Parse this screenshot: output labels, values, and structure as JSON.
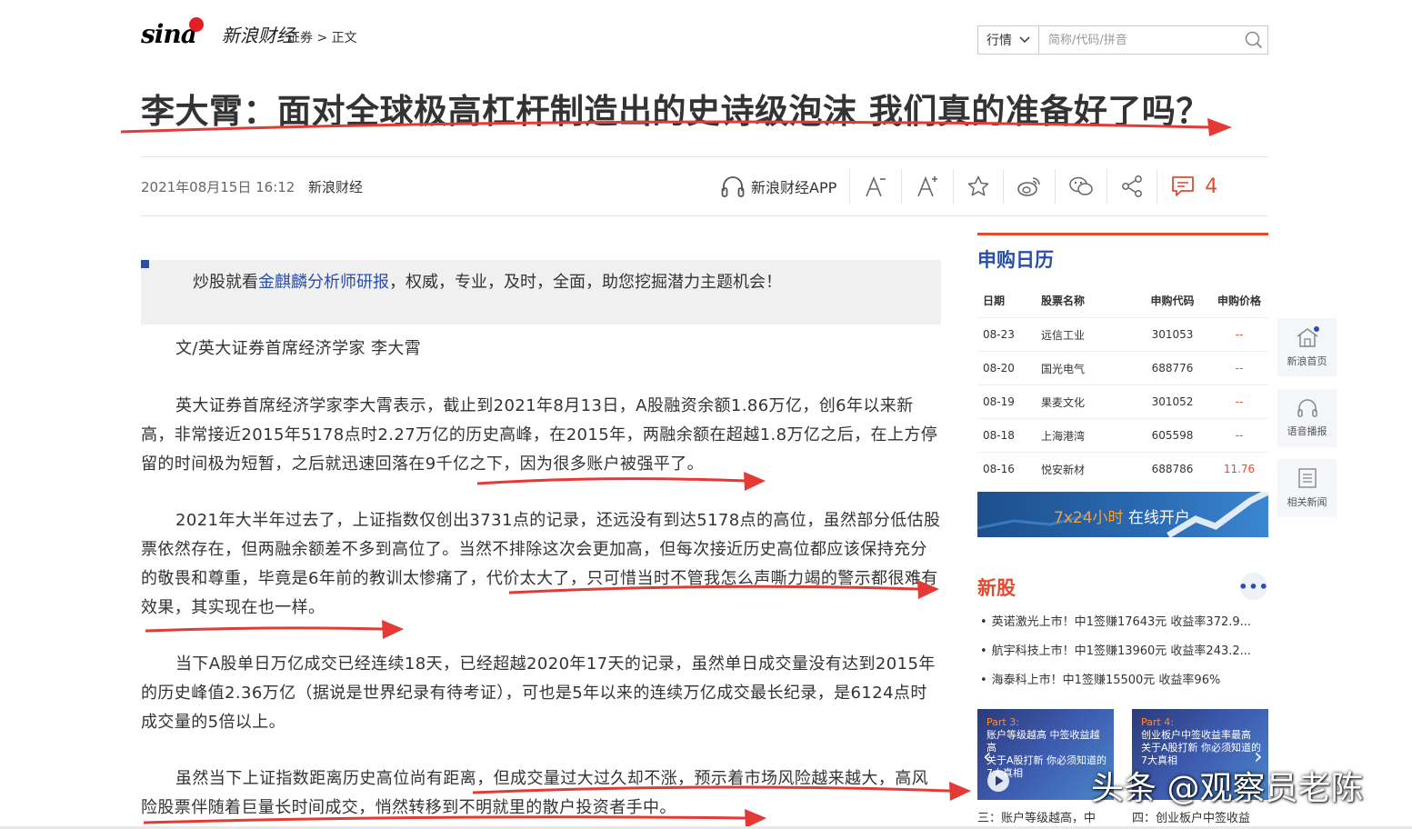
{
  "header": {
    "logo_sina": "sina",
    "logo_finance": "新浪财经",
    "breadcrumb": {
      "section": "证券",
      "sep": ">",
      "current": "正文"
    },
    "search": {
      "select_value": "行情",
      "placeholder": "简称/代码/拼音"
    }
  },
  "article": {
    "title": "李大霄：面对全球极高杠杆制造出的史诗级泡沫 我们真的准备好了吗？",
    "date": "2021年08月15日 16:12",
    "source": "新浪财经",
    "tools": {
      "app_label": "新浪财经APP",
      "comment_count": "4"
    },
    "ad": {
      "prefix": "炒股就看",
      "link": "金麒麟分析师研报",
      "suffix": "，权威，专业，及时，全面，助您挖掘潜力主题机会！"
    },
    "byline": "文/英大证券首席经济学家 李大霄",
    "paragraphs": [
      "英大证券首席经济学家李大霄表示，截止到2021年8月13日，A股融资余额1.86万亿，创6年以来新高，非常接近2015年5178点时2.27万亿的历史高峰，在2015年，两融余额在超越1.8万亿之后，在上方停留的时间极为短暂，之后就迅速回落在9千亿之下，因为很多账户被强平了。",
      "2021年大半年过去了，上证指数仅创出3731点的记录，还远没有到达5178点的高位，虽然部分低估股票依然存在，但两融余额差不多到高位了。当然不排除这次会更加高，但每次接近历史高位都应该保持充分的敬畏和尊重，毕竟是6年前的教训太惨痛了，代价太大了，只可惜当时不管我怎么声嘶力竭的警示都很难有效果，其实现在也一样。",
      "当下A股单日万亿成交已经连续18天，已经超越2020年17天的记录，虽然单日成交量没有达到2015年的历史峰值2.36万亿（据说是世界纪录有待考证），可也是5年以来的连续万亿成交最长纪录，是6124点时成交量的5倍以上。",
      "虽然当下上证指数距离历史高位尚有距离，但成交量过大过久却不涨，预示着市场风险越来越大，高风险股票伴随着巨量长时间成交，悄然转移到不明就里的散户投资者手中。"
    ]
  },
  "sidebar": {
    "ipo": {
      "title": "申购日历",
      "headers": [
        "日期",
        "股票名称",
        "申购代码",
        "申购价格"
      ],
      "rows": [
        [
          "08-23",
          "远信工业",
          "301053",
          "--"
        ],
        [
          "08-20",
          "国光电气",
          "688776",
          "--"
        ],
        [
          "08-19",
          "果麦文化",
          "301052",
          "--"
        ],
        [
          "08-18",
          "上海港湾",
          "605598",
          "--"
        ],
        [
          "08-16",
          "悦安新材",
          "688786",
          "11.76"
        ]
      ]
    },
    "banner": {
      "highlight": "7x24小时",
      "text": " 在线开户"
    },
    "new_stocks": {
      "title": "新股",
      "more": "•••",
      "items": [
        "英诺激光上市！中1签赚17643元 收益率372.9...",
        "航宇科技上市！中1签赚13960元 收益率243.2...",
        "海泰科上市！中1签赚15500元 收益率96%"
      ]
    },
    "thumbs": [
      {
        "part": "Part 3:",
        "line1": "账户等级越高 中签收益越高",
        "line2": "关于A股打新 你必须知道的7大真相",
        "caption": "三：账户等级越高，中"
      },
      {
        "part": "Part 4:",
        "line1": "创业板户中签收益率最高",
        "line2": "关于A股打新 你必须知道的7大真相",
        "caption": "四：创业板户中签收益"
      }
    ]
  },
  "float_toolbar": {
    "home": "新浪首页",
    "audio": "语音播报",
    "related": "相关新闻"
  },
  "watermark": "头条 @观察员老陈",
  "colors": {
    "accent_red": "#e24b30",
    "link_blue": "#2a4fa8",
    "arrow_red": "#e53935"
  }
}
